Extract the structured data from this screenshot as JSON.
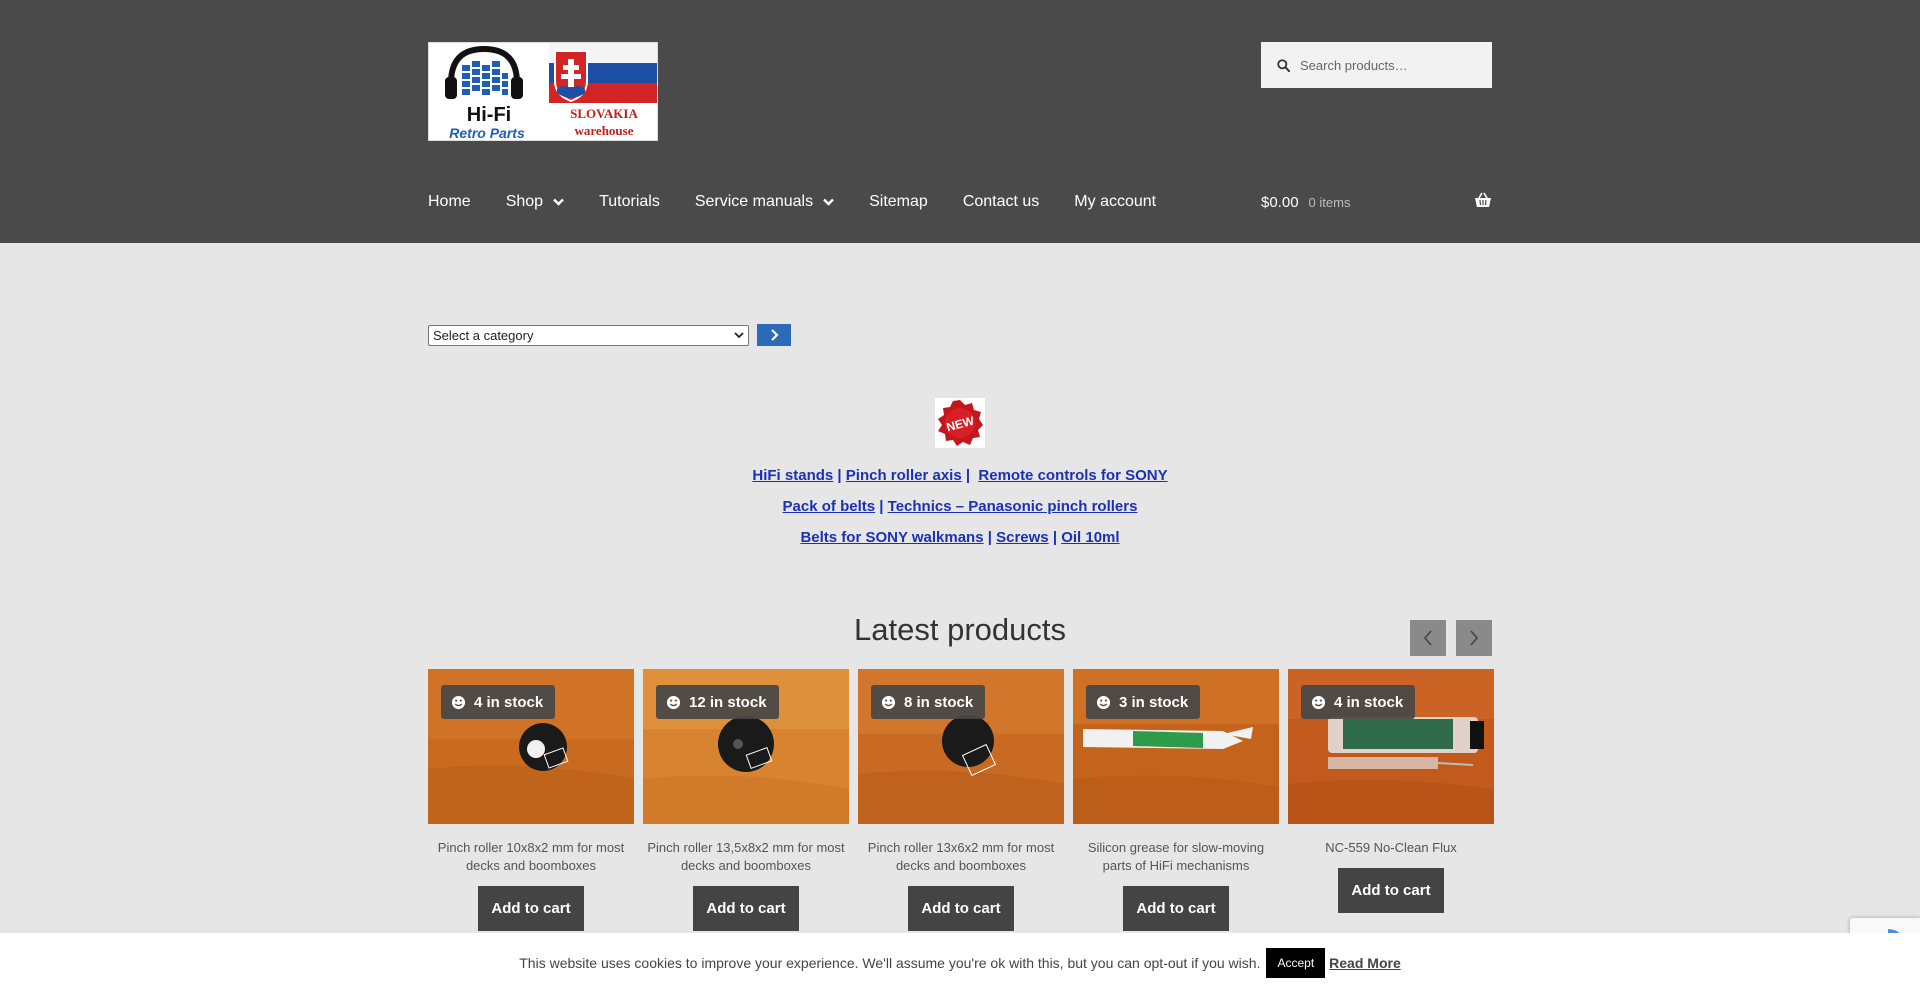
{
  "header": {
    "logo": {
      "text_top": "Hi-Fi",
      "text_bottom": "Retro Parts",
      "country": "SLOVAKIA",
      "sub": "warehouse"
    },
    "search": {
      "placeholder": "Search products…",
      "icon": "search-icon"
    },
    "nav": [
      {
        "label": "Home",
        "dropdown": false
      },
      {
        "label": "Shop",
        "dropdown": true
      },
      {
        "label": "Tutorials",
        "dropdown": false
      },
      {
        "label": "Service manuals",
        "dropdown": true
      },
      {
        "label": "Sitemap",
        "dropdown": false
      },
      {
        "label": "Contact us",
        "dropdown": false
      },
      {
        "label": "My account",
        "dropdown": false
      }
    ],
    "cart": {
      "amount": "$0.00",
      "count": "0 items",
      "icon": "basket-icon"
    }
  },
  "category": {
    "selected": "Select a category"
  },
  "badge": {
    "text": "NEW"
  },
  "links": {
    "line1": [
      "HiFi stands",
      "Pinch roller axis",
      "Remote controls for SONY"
    ],
    "line2": [
      "Pack of belts",
      "Technics – Panasonic pinch rollers"
    ],
    "line3": [
      "Belts for SONY walkmans",
      "Screws",
      "Oil 10ml"
    ]
  },
  "latest": {
    "title": "Latest products",
    "products": [
      {
        "stock": "4 in stock",
        "title": "Pinch roller 10x8x2 mm for most decks and boomboxes",
        "button": "Add to cart"
      },
      {
        "stock": "12 in stock",
        "title": "Pinch roller 13,5x8x2 mm for most decks and boomboxes",
        "button": "Add to cart"
      },
      {
        "stock": "8 in stock",
        "title": "Pinch roller 13x6x2 mm for most decks and boomboxes",
        "button": "Add to cart"
      },
      {
        "stock": "3 in stock",
        "title": "Silicon grease for slow-moving parts of HiFi mechanisms",
        "button": "Add to cart"
      },
      {
        "stock": "4 in stock",
        "title": "NC-559 No-Clean Flux",
        "button": "Add to cart"
      }
    ]
  },
  "cookie": {
    "message": "This website uses cookies to improve your experience. We'll assume you're ok with this, but you can opt-out if you wish.",
    "accept": "Accept",
    "read_more": "Read More"
  },
  "colors": {
    "header_bg": "#4a4a4a",
    "page_bg": "#e6e6e6",
    "link": "#1a31b7",
    "button": "#444444",
    "go_button": "#2b6ab6"
  }
}
